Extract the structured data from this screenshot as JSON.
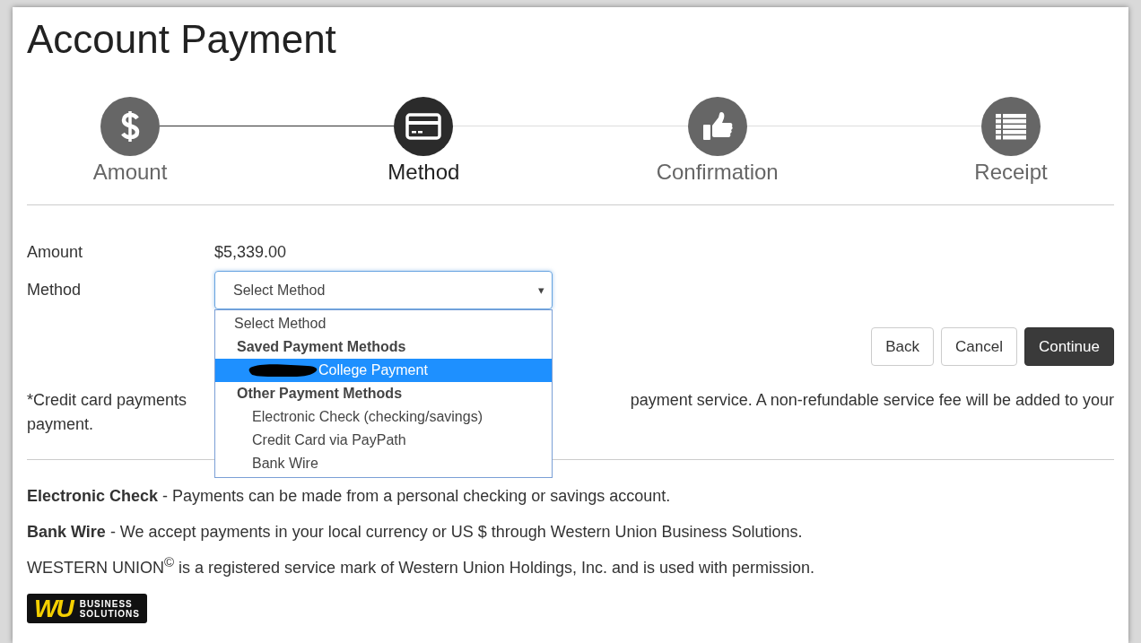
{
  "title": "Account Payment",
  "steps": [
    {
      "label": "Amount",
      "selected": false
    },
    {
      "label": "Method",
      "selected": true
    },
    {
      "label": "Confirmation",
      "selected": false
    },
    {
      "label": "Receipt",
      "selected": false
    }
  ],
  "form": {
    "amount_label": "Amount",
    "amount_value": "$5,339.00",
    "method_label": "Method",
    "method_value": "Select Method",
    "caret": "▾"
  },
  "dropdown": {
    "open": true,
    "options": [
      {
        "kind": "option",
        "label": "Select Method",
        "selected": false
      },
      {
        "kind": "group",
        "label": "Saved Payment Methods",
        "children": [
          {
            "kind": "option",
            "label": "College Payment",
            "redacted": true,
            "selected": true
          }
        ]
      },
      {
        "kind": "group",
        "label": "Other Payment Methods",
        "children": [
          {
            "kind": "option",
            "label": "Electronic Check (checking/savings)",
            "selected": false
          },
          {
            "kind": "option",
            "label": "Credit Card via PayPath",
            "selected": false
          },
          {
            "kind": "option",
            "label": "Bank Wire",
            "selected": false
          }
        ]
      }
    ]
  },
  "buttons": [
    {
      "label": "Back",
      "primary": false
    },
    {
      "label": "Cancel",
      "primary": false
    },
    {
      "label": "Continue",
      "primary": true
    }
  ],
  "note": {
    "start": "*Credit card payments",
    "end": "payment service. A non-refundable service fee will be added to your",
    "line2": "payment."
  },
  "info": [
    "**Electronic Check** - Payments can be made from a personal checking or savings  account.",
    "**Bank Wire** - We accept payments in your local currency or US $ through Western Union Business Solutions.",
    "WESTERN UNION$^{©}$ is a registered service mark of Western Union Holdings, Inc. and is used with permission."
  ],
  "logo": {
    "mark": "WU",
    "line1": "BUSINESS",
    "line2": "SOLUTIONS"
  }
}
